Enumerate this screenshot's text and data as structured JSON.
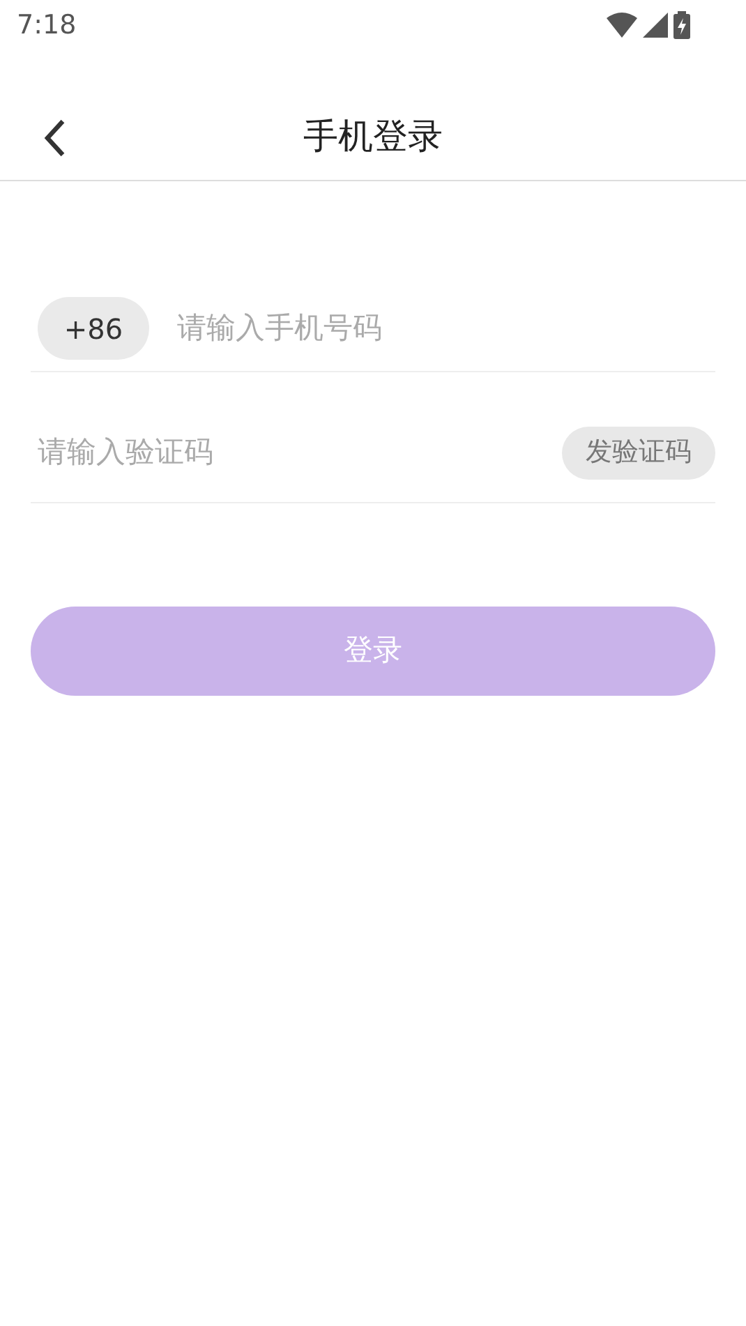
{
  "status_bar": {
    "time": "7:18"
  },
  "header": {
    "title": "手机登录"
  },
  "phone": {
    "country_code": "+86",
    "placeholder": "请输入手机号码"
  },
  "code": {
    "placeholder": "请输入验证码",
    "send_button": "发验证码"
  },
  "login_button": {
    "label": "登录",
    "disabled": true
  }
}
